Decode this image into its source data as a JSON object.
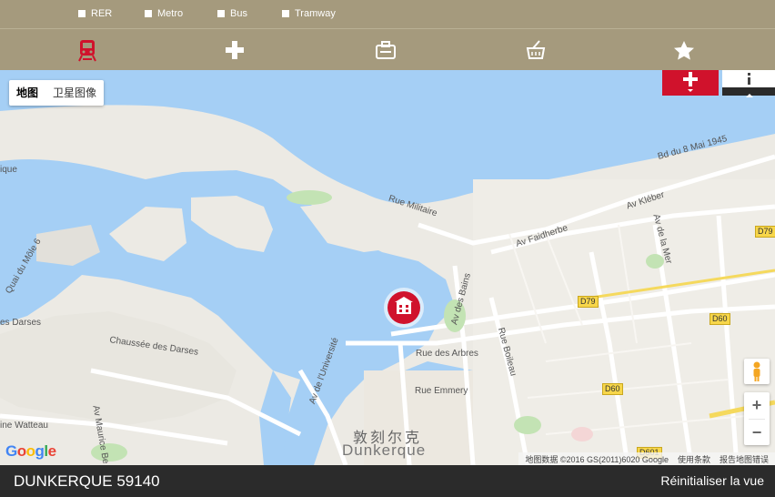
{
  "filters": [
    {
      "label": "RER"
    },
    {
      "label": "Metro"
    },
    {
      "label": "Bus"
    },
    {
      "label": "Tramway"
    }
  ],
  "categories": [
    {
      "icon": "train-icon",
      "active": true
    },
    {
      "icon": "health-cross-icon",
      "active": false
    },
    {
      "icon": "briefcase-icon",
      "active": false
    },
    {
      "icon": "shopping-basket-icon",
      "active": false
    },
    {
      "icon": "star-icon",
      "active": false
    }
  ],
  "map": {
    "maptype": {
      "map_label": "地图",
      "satellite_label": "卫星图像"
    },
    "labels": {
      "rue_militaire": "Rue Militaire",
      "av_faidherbe": "Av Faidherbe",
      "av_kleber": "Av Kléber",
      "av_de_la_mer": "Av de la Mer",
      "bd_8_mai": "Bd du 8 Mai 1945",
      "av_des_bains": "Av des Bains",
      "rue_des_arbres": "Rue des Arbres",
      "rue_boileau": "Rue Boileau",
      "rue_emmery": "Rue Emmery",
      "av_universite": "Av de l'Université",
      "chaussee_darses": "Chaussée des Darses",
      "rue_darses": "es Darses",
      "quai_mole": "Quai du Môle 6",
      "wattau": "ine Watteau",
      "av_maurice": "Av Maurice Be",
      "ique": "ique",
      "city_cn": "敦刻尔克",
      "city_fr": "Dunkerque"
    },
    "badges": {
      "d79a": "D79",
      "d79b": "D79",
      "d60a": "D60",
      "d60b": "D60",
      "d601": "D601"
    },
    "google": "Google",
    "attribution": [
      "地图数据 ©2016 GS(2011)6020 Google",
      "使用条款",
      "报告地图错误"
    ],
    "zoom_in": "+",
    "zoom_out": "−"
  },
  "footer": {
    "city": "DUNKERQUE 59140",
    "reset": "Réinitialiser la vue"
  },
  "colors": {
    "bar": "#a59a7d",
    "accent": "#d0122c",
    "water": "#a5cff5",
    "footer": "#2b2b2b"
  }
}
